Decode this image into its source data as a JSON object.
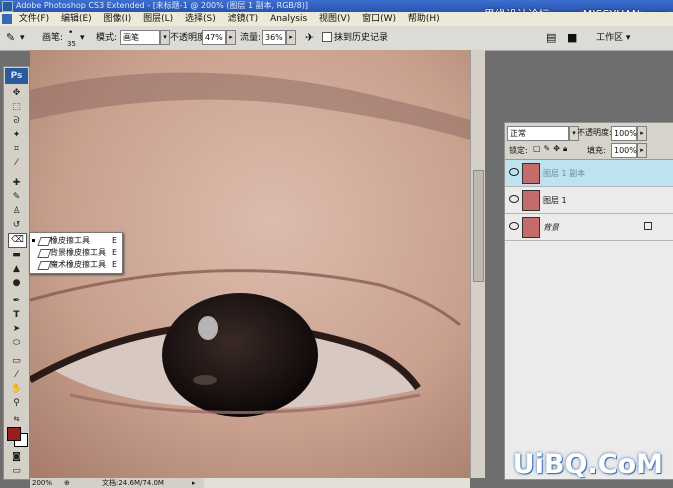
{
  "titlebar": {
    "text": "Adobe Photoshop CS3 Extended - [未标题-1 @ 200% (图层 1 副本, RGB/8)]"
  },
  "watermarks": {
    "top": "思缘设计论坛 www.MISSYUAN.com",
    "bottom": "UiBQ.CoM"
  },
  "menu": [
    "文件(F)",
    "编辑(E)",
    "图像(I)",
    "图层(L)",
    "选择(S)",
    "滤镜(T)",
    "Analysis",
    "视图(V)",
    "窗口(W)",
    "帮助(H)"
  ],
  "options": {
    "brush_label": "画笔:",
    "brush_size": "35",
    "mode_label": "模式:",
    "mode_value": "画笔",
    "opacity_label": "不透明度:",
    "opacity_value": "47%",
    "flow_label": "流量:",
    "flow_value": "36%",
    "history_label": "抹到历史记录",
    "workspace_label": "工作区"
  },
  "toolbox": {
    "logo": "Ps"
  },
  "flyout": {
    "items": [
      {
        "label": "橡皮擦工具",
        "key": "E"
      },
      {
        "label": "背景橡皮擦工具",
        "key": "E"
      },
      {
        "label": "魔术橡皮擦工具",
        "key": "E"
      }
    ]
  },
  "status": {
    "zoom": "200%",
    "doc": "文档:24.6M/74.0M"
  },
  "layers": {
    "mode": "正常",
    "opacity_label": "不透明度:",
    "opacity_value": "100%",
    "lock_label": "锁定:",
    "fill_label": "填充:",
    "fill_value": "100%",
    "items": [
      {
        "name": "图层 1 副本"
      },
      {
        "name": "图层 1"
      },
      {
        "name": "背景"
      }
    ]
  },
  "colors": {
    "foreground": "#9c1d1d",
    "background": "#ffffff",
    "selection": "#bfe2ef"
  }
}
